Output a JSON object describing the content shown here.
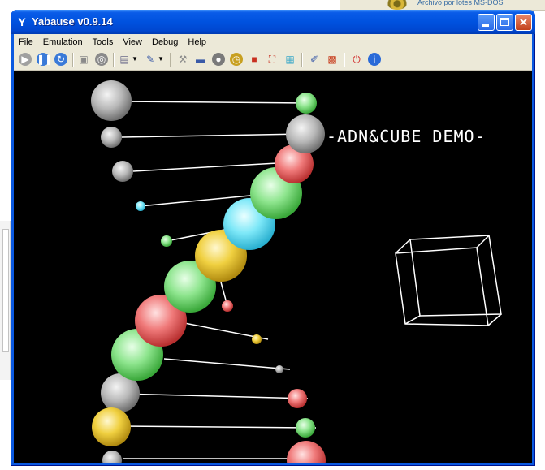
{
  "window": {
    "title": "Yabause v0.9.14",
    "icon": "yabause-icon",
    "controls": {
      "minimize": "minimize",
      "maximize": "maximize",
      "close": "close"
    }
  },
  "menu": [
    "File",
    "Emulation",
    "Tools",
    "View",
    "Debug",
    "Help"
  ],
  "toolbar": [
    {
      "name": "play-icon",
      "color": "#a0a0a0"
    },
    {
      "name": "pause-icon",
      "color": "#3a7ad8"
    },
    {
      "name": "reset-icon",
      "color": "#3a7ad8"
    },
    {
      "name": "disc-icon",
      "color": "#8a8a8a"
    },
    {
      "name": "open-cd-icon",
      "color": "#8a8a8a"
    },
    {
      "name": "save-state-icon",
      "color": "#6a6a8a"
    },
    {
      "name": "load-state-icon",
      "color": "#3a5aa8"
    },
    {
      "name": "wrench-icon",
      "color": "#8a8a8a"
    },
    {
      "name": "monitor-icon",
      "color": "#3a5aa8"
    },
    {
      "name": "cd-drive-icon",
      "color": "#7a7a7a"
    },
    {
      "name": "alarm-clock-icon",
      "color": "#c8a020"
    },
    {
      "name": "cube-icon",
      "color": "#c83020"
    },
    {
      "name": "fullscreen-icon",
      "color": "#c83020"
    },
    {
      "name": "chip-icon",
      "color": "#3aa8c8"
    },
    {
      "name": "pencil-icon",
      "color": "#3a5aa8"
    },
    {
      "name": "screenshot-icon",
      "color": "#c84020"
    },
    {
      "name": "power-icon",
      "color": "#d02020"
    },
    {
      "name": "about-icon",
      "color": "#2a6ad8"
    }
  ],
  "screen": {
    "demo_title": "-ADN&CUBE DEMO-"
  },
  "desktop": {
    "caption": "Archivo por lotes MS-DOS"
  }
}
